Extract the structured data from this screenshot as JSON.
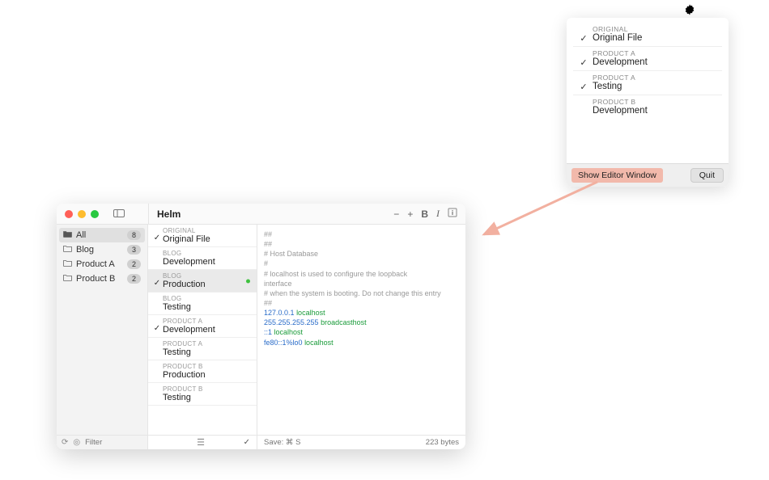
{
  "menubar": {
    "icon": "gear-icon"
  },
  "popup": {
    "items": [
      {
        "category": "ORIGINAL",
        "name": "Original File",
        "checked": true
      },
      {
        "category": "PRODUCT A",
        "name": "Development",
        "checked": true
      },
      {
        "category": "PRODUCT A",
        "name": "Testing",
        "checked": true
      },
      {
        "category": "PRODUCT B",
        "name": "Development",
        "checked": false
      }
    ],
    "show_editor_label": "Show Editor Window",
    "quit_label": "Quit"
  },
  "window": {
    "title": "Helm",
    "toolbar": {
      "minus": "−",
      "plus": "+",
      "bold": "B",
      "italic": "I",
      "info": "ⓘ"
    }
  },
  "sidebar": {
    "items": [
      {
        "icon": "folder-icon",
        "label": "All",
        "badge": "8",
        "active": true
      },
      {
        "icon": "folder-icon",
        "label": "Blog",
        "badge": "3",
        "active": false
      },
      {
        "icon": "folder-icon",
        "label": "Product A",
        "badge": "2",
        "active": false
      },
      {
        "icon": "folder-icon",
        "label": "Product B",
        "badge": "2",
        "active": false
      }
    ],
    "filter_placeholder": "Filter"
  },
  "entries": [
    {
      "category": "ORIGINAL",
      "name": "Original File",
      "checked": true,
      "selected": false,
      "modified": false
    },
    {
      "category": "BLOG",
      "name": "Development",
      "checked": false,
      "selected": false,
      "modified": false
    },
    {
      "category": "BLOG",
      "name": "Production",
      "checked": true,
      "selected": true,
      "modified": true
    },
    {
      "category": "BLOG",
      "name": "Testing",
      "checked": false,
      "selected": false,
      "modified": false
    },
    {
      "category": "PRODUCT A",
      "name": "Development",
      "checked": true,
      "selected": false,
      "modified": false
    },
    {
      "category": "PRODUCT A",
      "name": "Testing",
      "checked": false,
      "selected": false,
      "modified": false
    },
    {
      "category": "PRODUCT B",
      "name": "Production",
      "checked": false,
      "selected": false,
      "modified": false
    },
    {
      "category": "PRODUCT B",
      "name": "Testing",
      "checked": false,
      "selected": false,
      "modified": false
    }
  ],
  "entries_footer_check": "✓",
  "editor": {
    "lines": [
      {
        "type": "comment",
        "text": "##"
      },
      {
        "type": "comment",
        "text": "##"
      },
      {
        "type": "comment",
        "text": "# Host Database"
      },
      {
        "type": "comment",
        "text": "#"
      },
      {
        "type": "comment",
        "text": "# localhost is used to configure the loopback"
      },
      {
        "type": "comment",
        "text": "interface"
      },
      {
        "type": "comment",
        "text": "# when the system is booting. Do not change this entry"
      },
      {
        "type": "comment",
        "text": "##"
      },
      {
        "type": "hostline",
        "ip": "127.0.0.1",
        "host": "localhost"
      },
      {
        "type": "hostline",
        "ip": "255.255.255.255",
        "host": "broadcasthost"
      },
      {
        "type": "hostline",
        "ip": "::1",
        "host": "localhost"
      },
      {
        "type": "hostline",
        "ip": "fe80::1%lo0",
        "host": "localhost"
      }
    ]
  },
  "footer": {
    "save_hint": "Save: ⌘ S",
    "bytes_label": "223 bytes"
  }
}
